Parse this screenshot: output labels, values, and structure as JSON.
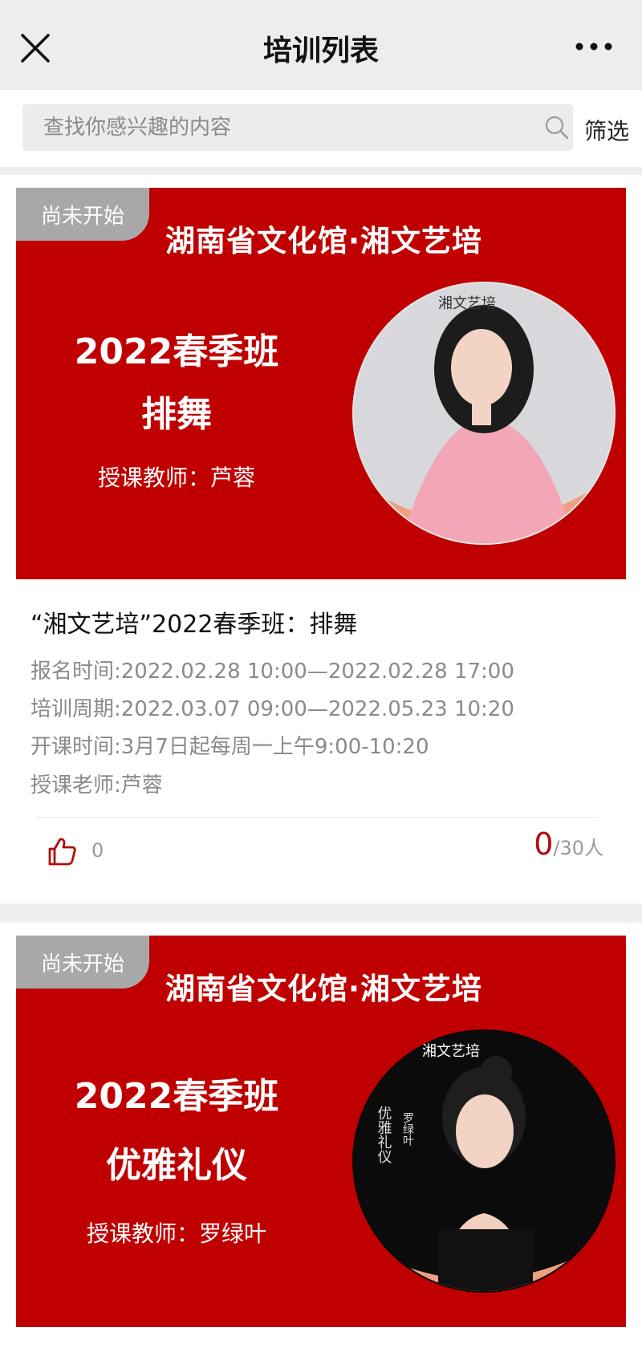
{
  "header": {
    "title": "培训列表"
  },
  "search": {
    "placeholder": "查找你感兴趣的内容",
    "filter_label": "筛选"
  },
  "courses": [
    {
      "status": "尚未开始",
      "banner_header": "湖南省文化馆·湘文艺培",
      "banner_season": "2022春季班",
      "banner_course": "排舞",
      "banner_teacher": "授课教师：芦蓉",
      "portrait_tag": "湘文艺培",
      "title": "“湘文艺培”2022春季班：排舞",
      "signup_time": "报名时间:2022.02.28 10:00—2022.02.28 17:00",
      "training_period": "培训周期:2022.03.07 09:00—2022.05.23 10:20",
      "class_time": "开课时间:3月7日起每周一上午9:00-10:20",
      "teacher": "授课老师:芦蓉",
      "likes": "0",
      "enrolled": "0",
      "capacity": "/30人"
    },
    {
      "status": "尚未开始",
      "banner_header": "湖南省文化馆·湘文艺培",
      "banner_season": "2022春季班",
      "banner_course": "优雅礼仪",
      "banner_teacher": "授课教师：罗绿叶",
      "portrait_tag": "湘文艺培",
      "portrait_side_text": "优雅礼仪",
      "portrait_name_text": "罗绿叶"
    }
  ],
  "colors": {
    "banner_red": "#c00000",
    "accent_red": "#b00d0d",
    "badge_gray": "#a8a8a8"
  }
}
